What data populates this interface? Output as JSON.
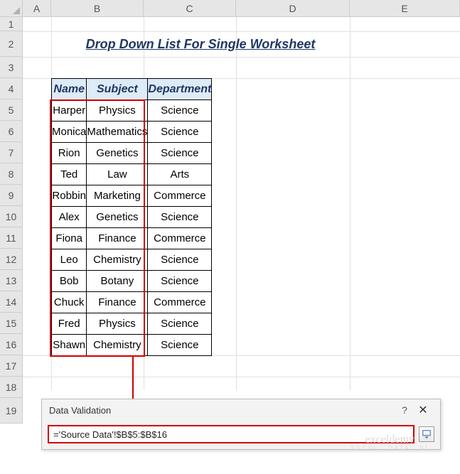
{
  "columns": [
    "A",
    "B",
    "C",
    "D",
    "E"
  ],
  "rows": [
    "1",
    "2",
    "3",
    "4",
    "5",
    "6",
    "7",
    "8",
    "9",
    "10",
    "11",
    "12",
    "13",
    "14",
    "15",
    "16",
    "17",
    "18",
    "19"
  ],
  "title": "Drop Down List For Single Worksheet",
  "headers": {
    "name": "Name",
    "subject": "Subject",
    "department": "Department"
  },
  "table": [
    {
      "name": "Harper",
      "subject": "Physics",
      "department": "Science"
    },
    {
      "name": "Monica",
      "subject": "Mathematics",
      "department": "Science"
    },
    {
      "name": "Rion",
      "subject": "Genetics",
      "department": "Science"
    },
    {
      "name": "Ted",
      "subject": "Law",
      "department": "Arts"
    },
    {
      "name": "Robbin",
      "subject": "Marketing",
      "department": "Commerce"
    },
    {
      "name": "Alex",
      "subject": "Genetics",
      "department": "Science"
    },
    {
      "name": "Fiona",
      "subject": "Finance",
      "department": "Commerce"
    },
    {
      "name": "Leo",
      "subject": "Chemistry",
      "department": "Science"
    },
    {
      "name": "Bob",
      "subject": "Botany",
      "department": "Science"
    },
    {
      "name": "Chuck",
      "subject": "Finance",
      "department": "Commerce"
    },
    {
      "name": "Fred",
      "subject": "Physics",
      "department": "Science"
    },
    {
      "name": "Shawn",
      "subject": "Chemistry",
      "department": "Science"
    }
  ],
  "dialog": {
    "title": "Data Validation",
    "help": "?",
    "close": "✕",
    "formula": "='Source Data'!$B$5:$B$16"
  },
  "watermark": {
    "brand": "exceldemy",
    "tag": "EXCEL · DATA · BI"
  }
}
